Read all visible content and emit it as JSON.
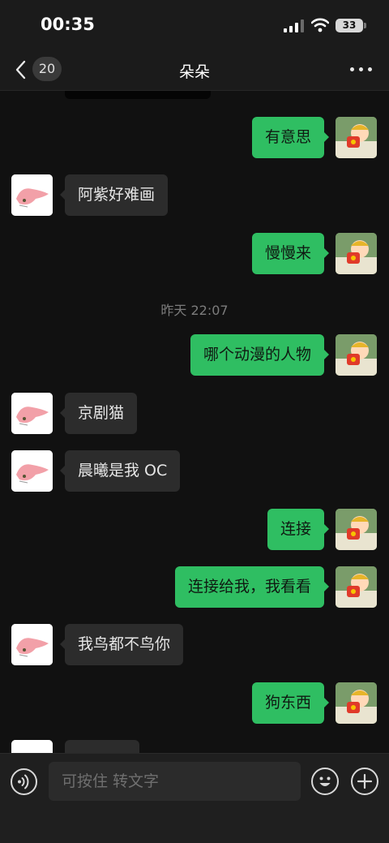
{
  "status_bar": {
    "time": "00:35",
    "battery": "33"
  },
  "nav": {
    "back_count": "20",
    "title": "朵朵"
  },
  "messages": [
    {
      "type": "time",
      "text": "昨天 22:07"
    },
    {
      "from": "me",
      "text": "有意思"
    },
    {
      "from": "other",
      "text": "阿紫好难画"
    },
    {
      "from": "me",
      "text": "慢慢来"
    },
    {
      "from": "me",
      "text": "哪个动漫的人物"
    },
    {
      "from": "other",
      "text": "京剧猫"
    },
    {
      "from": "other",
      "text": "晨曦是我 OC"
    },
    {
      "from": "me",
      "text": "连接"
    },
    {
      "from": "me",
      "text": "连接给我，我看看"
    },
    {
      "from": "other",
      "text": "我鸟都不鸟你"
    },
    {
      "from": "me",
      "text": "狗东西"
    }
  ],
  "input": {
    "placeholder": "可按住 转文字"
  },
  "icons": {
    "back": "chevron-left-icon",
    "more": "more-dots-icon",
    "voice": "voice-icon",
    "emoji": "emoji-icon",
    "plus": "plus-icon",
    "signal": "cellular-signal-icon",
    "wifi": "wifi-icon"
  },
  "colors": {
    "my_bubble": "#2fbe62",
    "other_bubble": "#2c2c2c",
    "background": "#111111"
  }
}
